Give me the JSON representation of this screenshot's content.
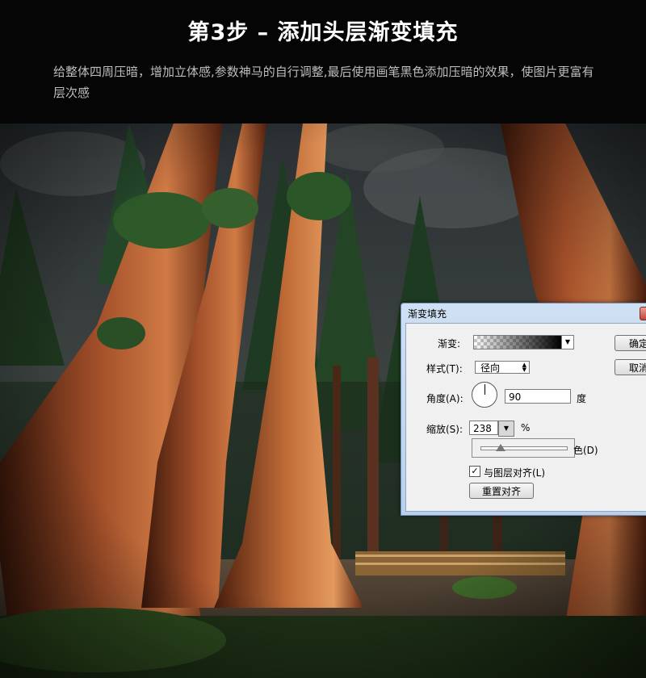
{
  "header": {
    "title": "第3步 – 添加头层渐变填充",
    "description": "给整体四周压暗，增加立体感,参数神马的自行调整,最后使用画笔黑色添加压暗的效果，使图片更富有层次感"
  },
  "dialog": {
    "title": "渐变填充",
    "gradient_label": "渐变:",
    "style_label": "样式(T):",
    "style_value": "径向",
    "angle_label": "角度(A):",
    "angle_value": "90",
    "angle_unit": "度",
    "scale_label": "缩放(S):",
    "scale_value": "238",
    "scale_unit": "%",
    "scale_slider_level": 0.238,
    "partial_checkbox_label": "色(D)",
    "align_checkbox_label": "与图层对齐(L)",
    "align_checked": true,
    "reset_button": "重置对齐",
    "ok_button": "确定",
    "cancel_button": "取消"
  },
  "icons": {
    "dropdown": "chevron-down-icon",
    "checkmark": "check-icon",
    "close": "close-icon"
  },
  "colors": {
    "header_bg": "#050505",
    "title_text": "#ffffff",
    "desc_text": "#bdbdbd",
    "dialog_frame": "#c4d8f0",
    "close_button": "#c8493d"
  }
}
